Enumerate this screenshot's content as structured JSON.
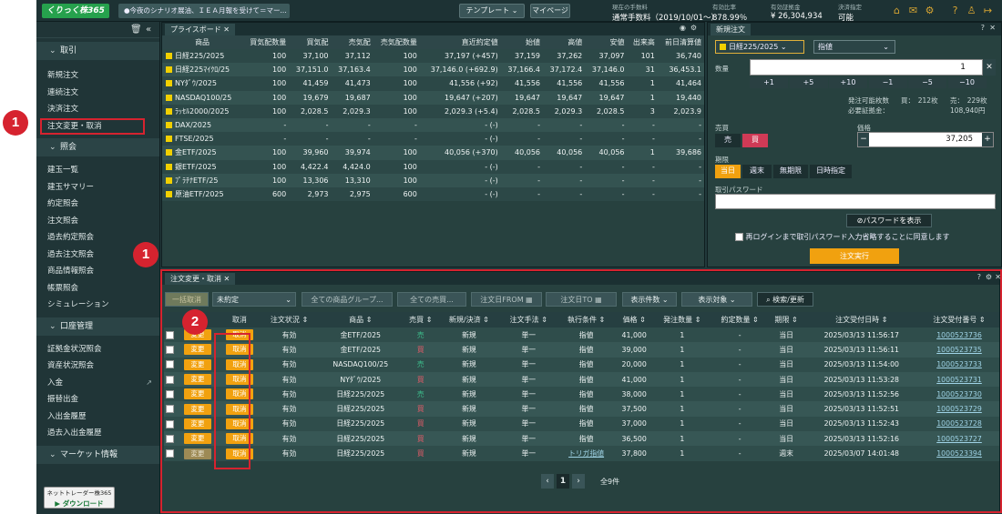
{
  "topbar": {
    "logo": "くりっく株365",
    "ticker": "●今夜のシナリオ展油、ＩＥＡ月報を受けて＝マー...",
    "template": "テンプレート",
    "mypage": "マイページ",
    "fee_label": "現在の手数料",
    "fee_value": "通常手数料（2019/10/01〜）",
    "ratio_label": "有効比率",
    "ratio_value": "878.99％",
    "margin_label": "有効証拠金",
    "margin_value": "¥ 26,304,934",
    "settle_label": "決済指定",
    "settle_value": "可能"
  },
  "sidebar": {
    "sections": [
      {
        "label": "取引",
        "items": [
          "新規注文",
          "連続注文",
          "決済注文",
          "注文変更・取消"
        ]
      },
      {
        "label": "照会",
        "items": [
          "建玉一覧",
          "建玉サマリー",
          "約定照会",
          "注文照会",
          "過去約定照会",
          "過去注文照会",
          "商品情報照会",
          "帳票照会",
          "シミュレーション"
        ]
      },
      {
        "label": "口座管理",
        "items": [
          "証拠金状況照会",
          "資産状況照会",
          "入金",
          "振替出金",
          "入出金履歴",
          "過去入出金履歴"
        ]
      },
      {
        "label": "マーケット情報",
        "items": []
      }
    ],
    "download_top": "ネットトレーダー株365",
    "download_btn": "ダウンロード"
  },
  "price_board": {
    "tab": "プライスボード",
    "headers": [
      "商品",
      "買気配数量",
      "買気配",
      "売気配",
      "売気配数量",
      "直近約定値",
      "始値",
      "高値",
      "安値",
      "出来高",
      "前日清算値"
    ],
    "rows": [
      [
        "日経225/2025",
        "100",
        "37,100",
        "37,112",
        "100",
        "37,197  (+457)",
        "37,159",
        "37,262",
        "37,097",
        "101",
        "36,740"
      ],
      [
        "日経225ﾏｲｸﾛ/25",
        "100",
        "37,151.0",
        "37,163.4",
        "100",
        "37,146.0  (+692.9)",
        "37,166.4",
        "37,172.4",
        "37,146.0",
        "31",
        "36,453.1"
      ],
      [
        "NYﾀﾞｳ/2025",
        "100",
        "41,459",
        "41,473",
        "100",
        "41,556  (+92)",
        "41,556",
        "41,556",
        "41,556",
        "1",
        "41,464"
      ],
      [
        "NASDAQ100/25",
        "100",
        "19,679",
        "19,687",
        "100",
        "19,647  (+207)",
        "19,647",
        "19,647",
        "19,647",
        "1",
        "19,440"
      ],
      [
        "ﾗｯｾﾙ2000/2025",
        "100",
        "2,028.5",
        "2,029.3",
        "100",
        "2,029.3  (+5.4)",
        "2,028.5",
        "2,029.3",
        "2,028.5",
        "3",
        "2,023.9"
      ],
      [
        "DAX/2025",
        "-",
        "-",
        "-",
        "-",
        "-  (-)",
        "-",
        "-",
        "-",
        "-",
        "-"
      ],
      [
        "FTSE/2025",
        "-",
        "-",
        "-",
        "-",
        "-  (-)",
        "-",
        "-",
        "-",
        "-",
        "-"
      ],
      [
        "金ETF/2025",
        "100",
        "39,960",
        "39,974",
        "100",
        "40,056  (+370)",
        "40,056",
        "40,056",
        "40,056",
        "1",
        "39,686"
      ],
      [
        "銀ETF/2025",
        "100",
        "4,422.4",
        "4,424.0",
        "100",
        "-  (-)",
        "-",
        "-",
        "-",
        "-",
        "-"
      ],
      [
        "ﾌﾟﾗﾁﾅETF/25",
        "100",
        "13,306",
        "13,310",
        "100",
        "-  (-)",
        "-",
        "-",
        "-",
        "-",
        "-"
      ],
      [
        "原油ETF/2025",
        "600",
        "2,973",
        "2,975",
        "600",
        "-  (-)",
        "-",
        "-",
        "-",
        "-",
        "-"
      ]
    ]
  },
  "new_order": {
    "tab": "新規注文",
    "product": "日経225/2025",
    "order_type": "指値",
    "qty_label": "数量",
    "qty_value": "1",
    "steps": [
      "+1",
      "+5",
      "+10",
      "−1",
      "−5",
      "−10"
    ],
    "avail_label": "発注可能枚数",
    "avail_buy": "買：　212枚",
    "avail_sell": "売：　229枚",
    "req_label": "必要証拠金：",
    "req_value": "108,940円",
    "side_label": "売買",
    "sell": "売",
    "buy": "買",
    "price_label": "価格",
    "price_value": "37,205",
    "period_label": "期限",
    "periods": [
      "当日",
      "週末",
      "無期限",
      "日時指定"
    ],
    "pw_label": "取引パスワード",
    "pw_show": "パスワードを表示",
    "remember": "再ログインまで取引パスワード入力省略することに同意します",
    "submit": "注文実行"
  },
  "orders": {
    "tab": "注文変更・取消",
    "bulk": "一括取消",
    "status_filter": "未約定",
    "product_filter": "全ての商品グループ...",
    "trade_filter": "全ての売買...",
    "from": "注文日FROM",
    "to": "注文日TO",
    "count": "表示件数",
    "target": "表示対象",
    "search": "検索/更新",
    "headers": [
      "",
      "変更",
      "取消",
      "注文状況",
      "商品",
      "売買",
      "新規/決済",
      "注文手法",
      "執行条件",
      "価格",
      "発注数量",
      "約定数量",
      "期限",
      "注文受付日時",
      "注文受付番号"
    ],
    "change_label": "変更",
    "cancel_label": "取消",
    "rows": [
      [
        "有効",
        "金ETF/2025",
        "売",
        "新規",
        "単一",
        "指値",
        "41,000",
        "1",
        "-",
        "当日",
        "2025/03/13 11:56:17",
        "1000523736"
      ],
      [
        "有効",
        "金ETF/2025",
        "買",
        "新規",
        "単一",
        "指値",
        "39,000",
        "1",
        "-",
        "当日",
        "2025/03/13 11:56:11",
        "1000523735"
      ],
      [
        "有効",
        "NASDAQ100/25",
        "売",
        "新規",
        "単一",
        "指値",
        "20,000",
        "1",
        "-",
        "当日",
        "2025/03/13 11:54:00",
        "1000523733"
      ],
      [
        "有効",
        "NYﾀﾞｳ/2025",
        "買",
        "新規",
        "単一",
        "指値",
        "41,000",
        "1",
        "-",
        "当日",
        "2025/03/13 11:53:28",
        "1000523731"
      ],
      [
        "有効",
        "日経225/2025",
        "売",
        "新規",
        "単一",
        "指値",
        "38,000",
        "1",
        "-",
        "当日",
        "2025/03/13 11:52:56",
        "1000523730"
      ],
      [
        "有効",
        "日経225/2025",
        "買",
        "新規",
        "単一",
        "指値",
        "37,500",
        "1",
        "-",
        "当日",
        "2025/03/13 11:52:51",
        "1000523729"
      ],
      [
        "有効",
        "日経225/2025",
        "買",
        "新規",
        "単一",
        "指値",
        "37,000",
        "1",
        "-",
        "当日",
        "2025/03/13 11:52:43",
        "1000523728"
      ],
      [
        "有効",
        "日経225/2025",
        "買",
        "新規",
        "単一",
        "指値",
        "36,500",
        "1",
        "-",
        "当日",
        "2025/03/13 11:52:16",
        "1000523727"
      ],
      [
        "有効",
        "日経225/2025",
        "買",
        "新規",
        "単一",
        "トリガ指値",
        "37,800",
        "1",
        "-",
        "週末",
        "2025/03/07 14:01:48",
        "1000523394"
      ]
    ],
    "page": "1",
    "total": "全9件"
  },
  "badges": [
    "1",
    "1",
    "2"
  ],
  "colors": {
    "accent": "#f1a10f",
    "highlight": "#d6232f",
    "bid": "#3dbf8c",
    "ask": "#e25c69"
  }
}
